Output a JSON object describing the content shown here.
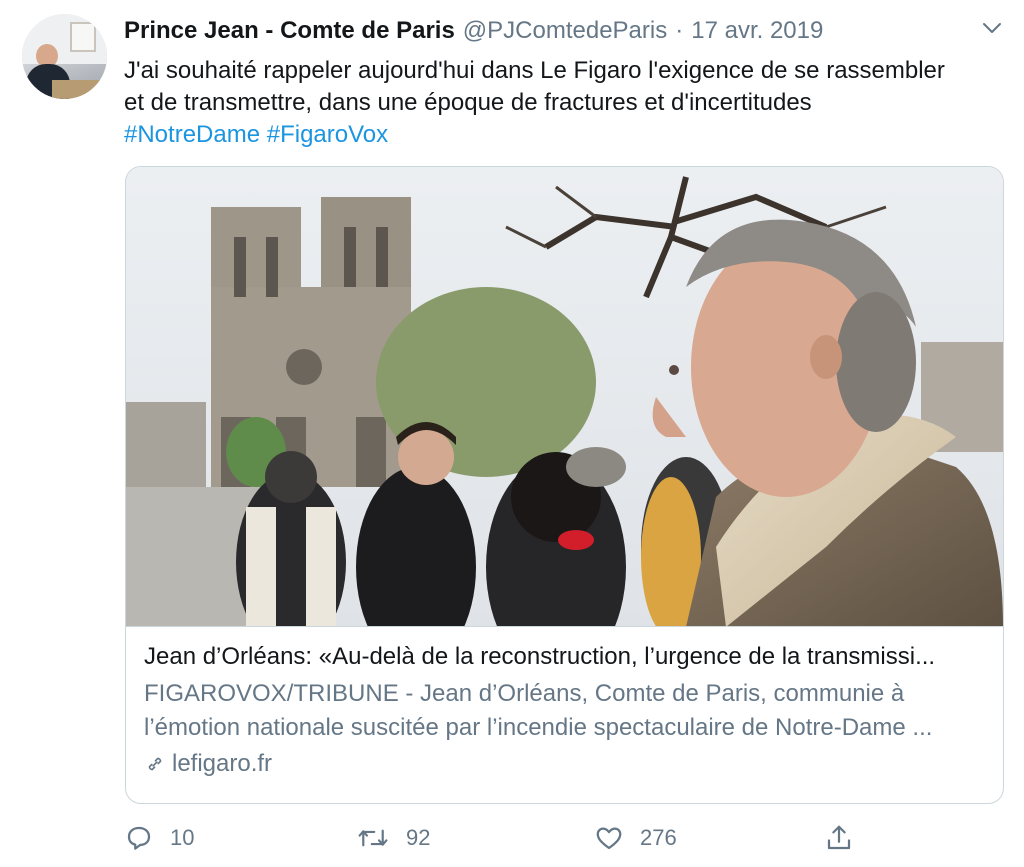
{
  "author": {
    "name": "Prince Jean - Comte de Paris",
    "handle": "@PJComtedeParis",
    "separator": "·",
    "date": "17 avr. 2019"
  },
  "tweet": {
    "lines": [
      "J'ai souhaité rappeler aujourd'hui dans Le Figaro l'exigence de se rassembler",
      "et de transmettre, dans une époque de fractures et d'incertitudes"
    ],
    "hashtags": [
      "#NotreDame",
      "#FigaroVox"
    ]
  },
  "card": {
    "title": "Jean d’Orléans: «Au-delà de la reconstruction, l’urgence de la transmissi...",
    "description_lines": [
      "FIGAROVOX/TRIBUNE - Jean d’Orléans, Comte de Paris, communie à",
      "l’émotion nationale suscitée par l’incendie spectaculaire de Notre-Dame ..."
    ],
    "domain": "lefigaro.fr",
    "link_icon": "link-icon"
  },
  "actions": {
    "reply_count": "10",
    "retweet_count": "92",
    "like_count": "276",
    "reply_icon": "reply-icon",
    "retweet_icon": "retweet-icon",
    "like_icon": "heart-icon",
    "share_icon": "share-icon"
  },
  "colors": {
    "text": "#14171a",
    "secondary": "#657786",
    "hashtag": "#1b95e0",
    "border": "#ccd6dd"
  }
}
